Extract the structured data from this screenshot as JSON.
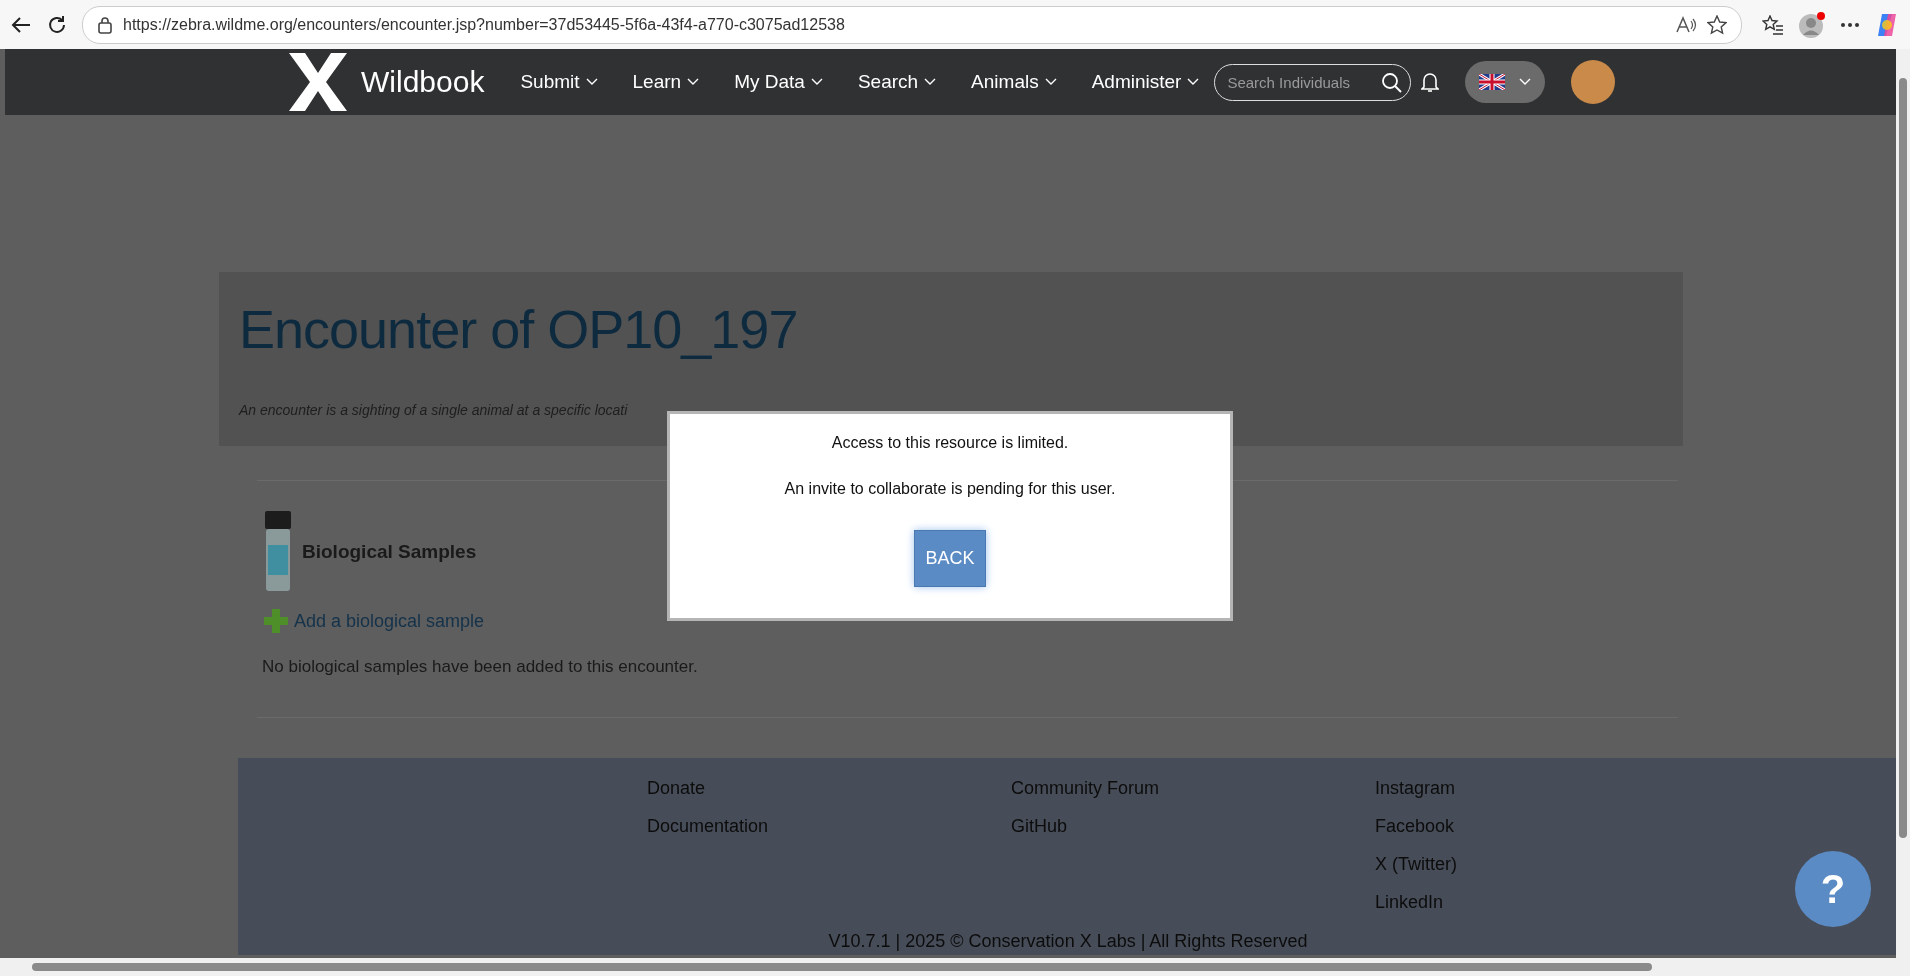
{
  "browser": {
    "url": "https://zebra.wildme.org/encounters/encounter.jsp?number=37d53445-5f6a-43f4-a770-c3075ad12538"
  },
  "navbar": {
    "brand": "Wildbook",
    "menu": [
      {
        "label": "Submit"
      },
      {
        "label": "Learn"
      },
      {
        "label": "My Data"
      },
      {
        "label": "Search"
      },
      {
        "label": "Animals"
      },
      {
        "label": "Administer"
      }
    ],
    "search": {
      "placeholder": "Search Individuals"
    }
  },
  "header": {
    "title": "Encounter of OP10_197",
    "subtitle": "An encounter is a sighting of a single animal at a specific locati"
  },
  "biological_samples": {
    "heading": "Biological Samples",
    "add_link": "Add a biological sample",
    "empty_message": "No biological samples have been added to this encounter."
  },
  "footer": {
    "columns": [
      [
        "Donate",
        "Documentation"
      ],
      [
        "Community Forum",
        "GitHub"
      ],
      [
        "Instagram",
        "Facebook",
        "X (Twitter)",
        "LinkedIn"
      ]
    ],
    "copyright": "V10.7.1 | 2025 © Conservation X Labs | All Rights Reserved"
  },
  "modal": {
    "lines": [
      "Access to this resource is limited.",
      "An invite to collaborate is pending for this user."
    ],
    "button": "BACK"
  },
  "help_button": {
    "label": "?"
  }
}
